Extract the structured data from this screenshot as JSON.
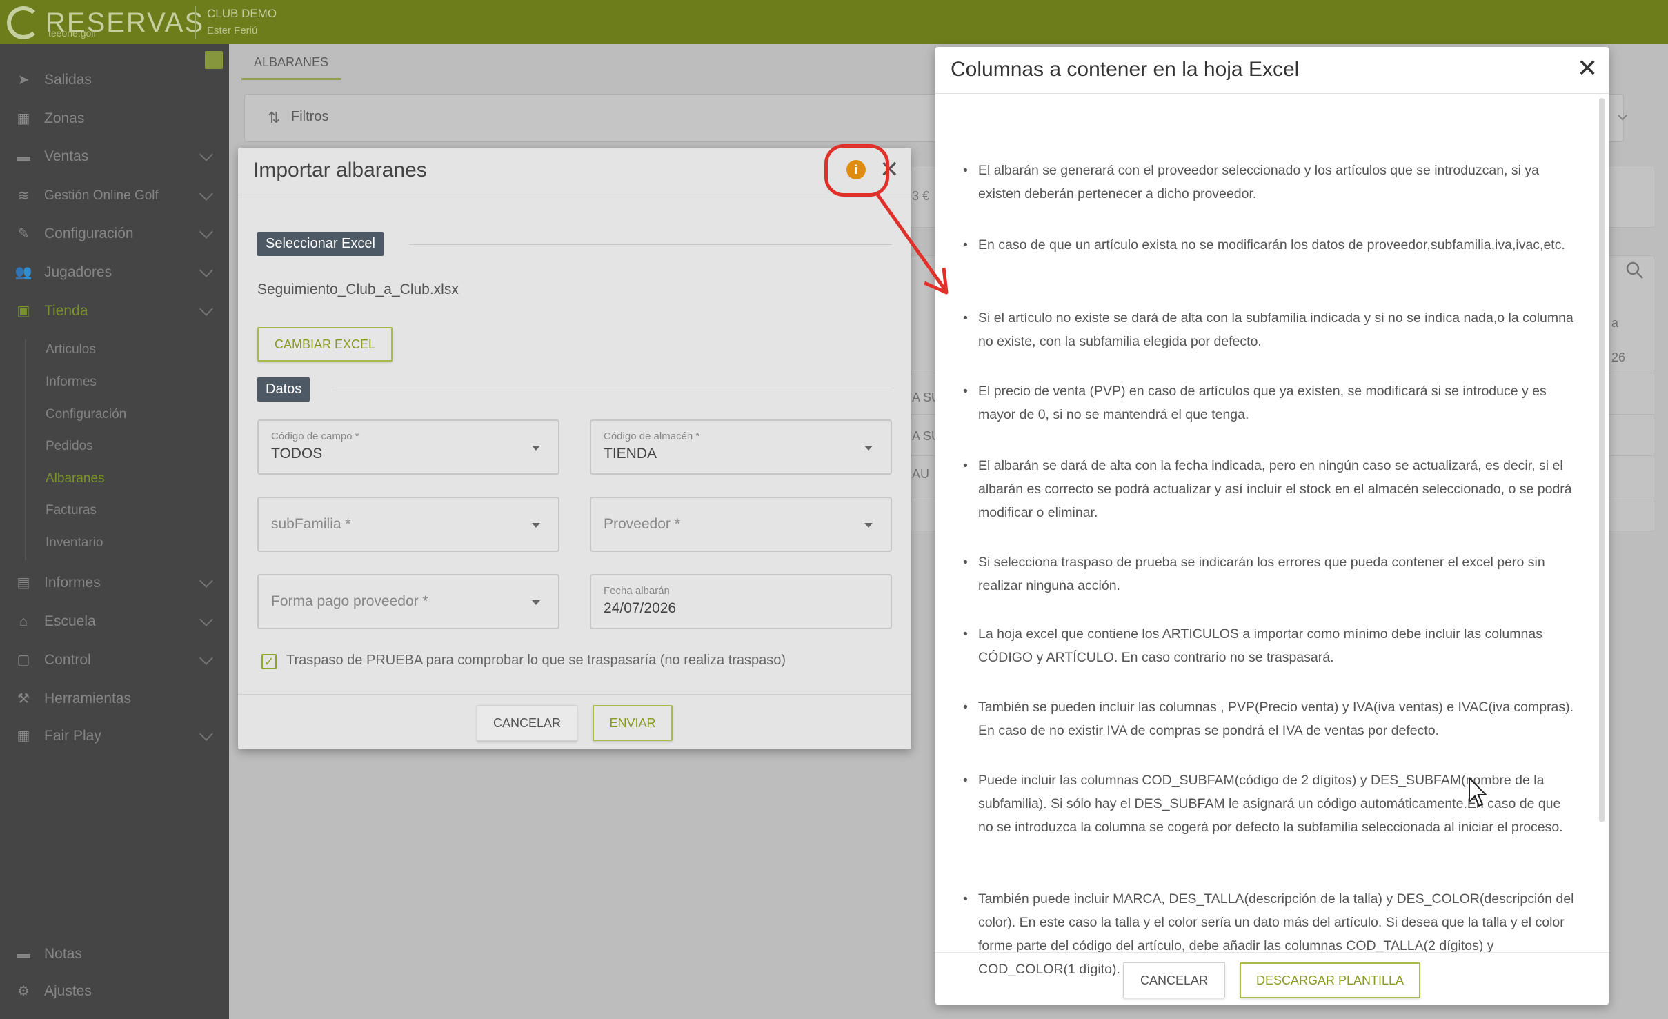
{
  "app": {
    "brand": "RESERVAS",
    "brand_sub": "teeone.golf",
    "club": "CLUB DEMO",
    "user": "Ester Feriú"
  },
  "sidebar": {
    "items": [
      {
        "label": "Salidas",
        "icon": "paper-plane-icon"
      },
      {
        "label": "Zonas",
        "icon": "map-icon"
      },
      {
        "label": "Ventas",
        "icon": "credit-card-icon"
      },
      {
        "label": "Gestión Online Golf",
        "icon": "wifi-icon"
      },
      {
        "label": "Configuración",
        "icon": "wrench-icon"
      },
      {
        "label": "Jugadores",
        "icon": "users-icon"
      },
      {
        "label": "Tienda",
        "icon": "store-icon"
      },
      {
        "label": "Informes",
        "icon": "document-icon"
      },
      {
        "label": "Escuela",
        "icon": "school-icon"
      },
      {
        "label": "Control",
        "icon": "clipboard-icon"
      },
      {
        "label": "Herramientas",
        "icon": "toolbox-icon"
      },
      {
        "label": "Fair Play",
        "icon": "grid-icon"
      }
    ],
    "tienda_sub": [
      "Articulos",
      "Informes",
      "Configuración",
      "Pedidos",
      "Albaranes",
      "Facturas",
      "Inventario"
    ],
    "bottom": [
      {
        "label": "Notas",
        "icon": "note-icon"
      },
      {
        "label": "Ajustes",
        "icon": "gear-icon"
      }
    ]
  },
  "main": {
    "tab": "ALBARANES",
    "filters_label": "Filtros",
    "bg_fragments": [
      "3 €",
      "26",
      "A SU",
      "A SU",
      "AU",
      "a"
    ]
  },
  "import_modal": {
    "title": "Importar albaranes",
    "section_excel": "Seleccionar Excel",
    "file_name": "Seguimiento_Club_a_Club.xlsx",
    "change_button": "CAMBIAR EXCEL",
    "section_datos": "Datos",
    "fields": {
      "campo_label": "Código de campo *",
      "campo_value": "TODOS",
      "almacen_label": "Código de almacén *",
      "almacen_value": "TIENDA",
      "subfamilia_placeholder": "subFamilia *",
      "proveedor_placeholder": "Proveedor *",
      "forma_pago_placeholder": "Forma pago proveedor *",
      "fecha_label": "Fecha albarán",
      "fecha_value": "24/07/2026"
    },
    "test_checkbox_label": "Traspaso de PRUEBA para comprobar lo que se traspasaría (no realiza traspaso)",
    "cancel": "CANCELAR",
    "send": "ENVIAR"
  },
  "info_modal": {
    "title": "Columnas a contener en la hoja Excel",
    "bullets": [
      "El albarán se generará con el proveedor seleccionado y los artículos que se introduzcan, si ya existen deberán pertenecer a dicho proveedor.",
      "En caso de que un artículo exista no se modificarán los datos de proveedor,subfamilia,iva,ivac,etc.",
      "Si el artículo no existe se dará de alta con la subfamilia indicada y si no se indica nada,o la columna no existe, con la subfamilia elegida por defecto.",
      "El precio de venta (PVP) en caso de artículos que ya existen, se modificará si se introduce y es mayor de 0, si no se mantendrá el que tenga.",
      "El albarán se dará de alta con la fecha indicada, pero en ningún caso se actualizará, es decir, si el albarán es correcto se podrá actualizar y así incluir el stock en el almacén seleccionado, o se podrá modificar o eliminar.",
      "Si selecciona traspaso de prueba se indicarán los errores que pueda contener el excel pero sin realizar ninguna acción.",
      "La hoja excel que contiene los ARTICULOS a importar como mínimo debe incluir las columnas CÓDIGO y ARTÍCULO. En caso contrario no se traspasará.",
      "También se pueden incluir las columnas , PVP(Precio venta) y IVA(iva ventas) e IVAC(iva compras). En caso de no existir IVA de compras se pondrá el IVA de ventas por defecto.",
      "Puede incluir las columnas COD_SUBFAM(código de 2 dígitos) y DES_SUBFAM(nombre de la subfamilia). Si sólo hay el DES_SUBFAM le asignará un código automáticamente.En caso de que no se introduzca la columna se cogerá por defecto la subfamilia seleccionada al iniciar el proceso.",
      "También puede incluir MARCA, DES_TALLA(descripción de la talla) y DES_COLOR(descripción del color). En este caso la talla y el color sería un dato más del artículo. Si desea que la talla y el color forme parte del código del artículo, debe añadir las columnas COD_TALLA(2 dígitos) y COD_COLOR(1 dígito)."
    ],
    "cancel": "CANCELAR",
    "download": "DESCARGAR PLANTILLA"
  },
  "colors": {
    "brand": "#6d7d1b",
    "accent": "#8ea62a",
    "annotation": "#e0302a",
    "info_badge": "#e08c10"
  }
}
